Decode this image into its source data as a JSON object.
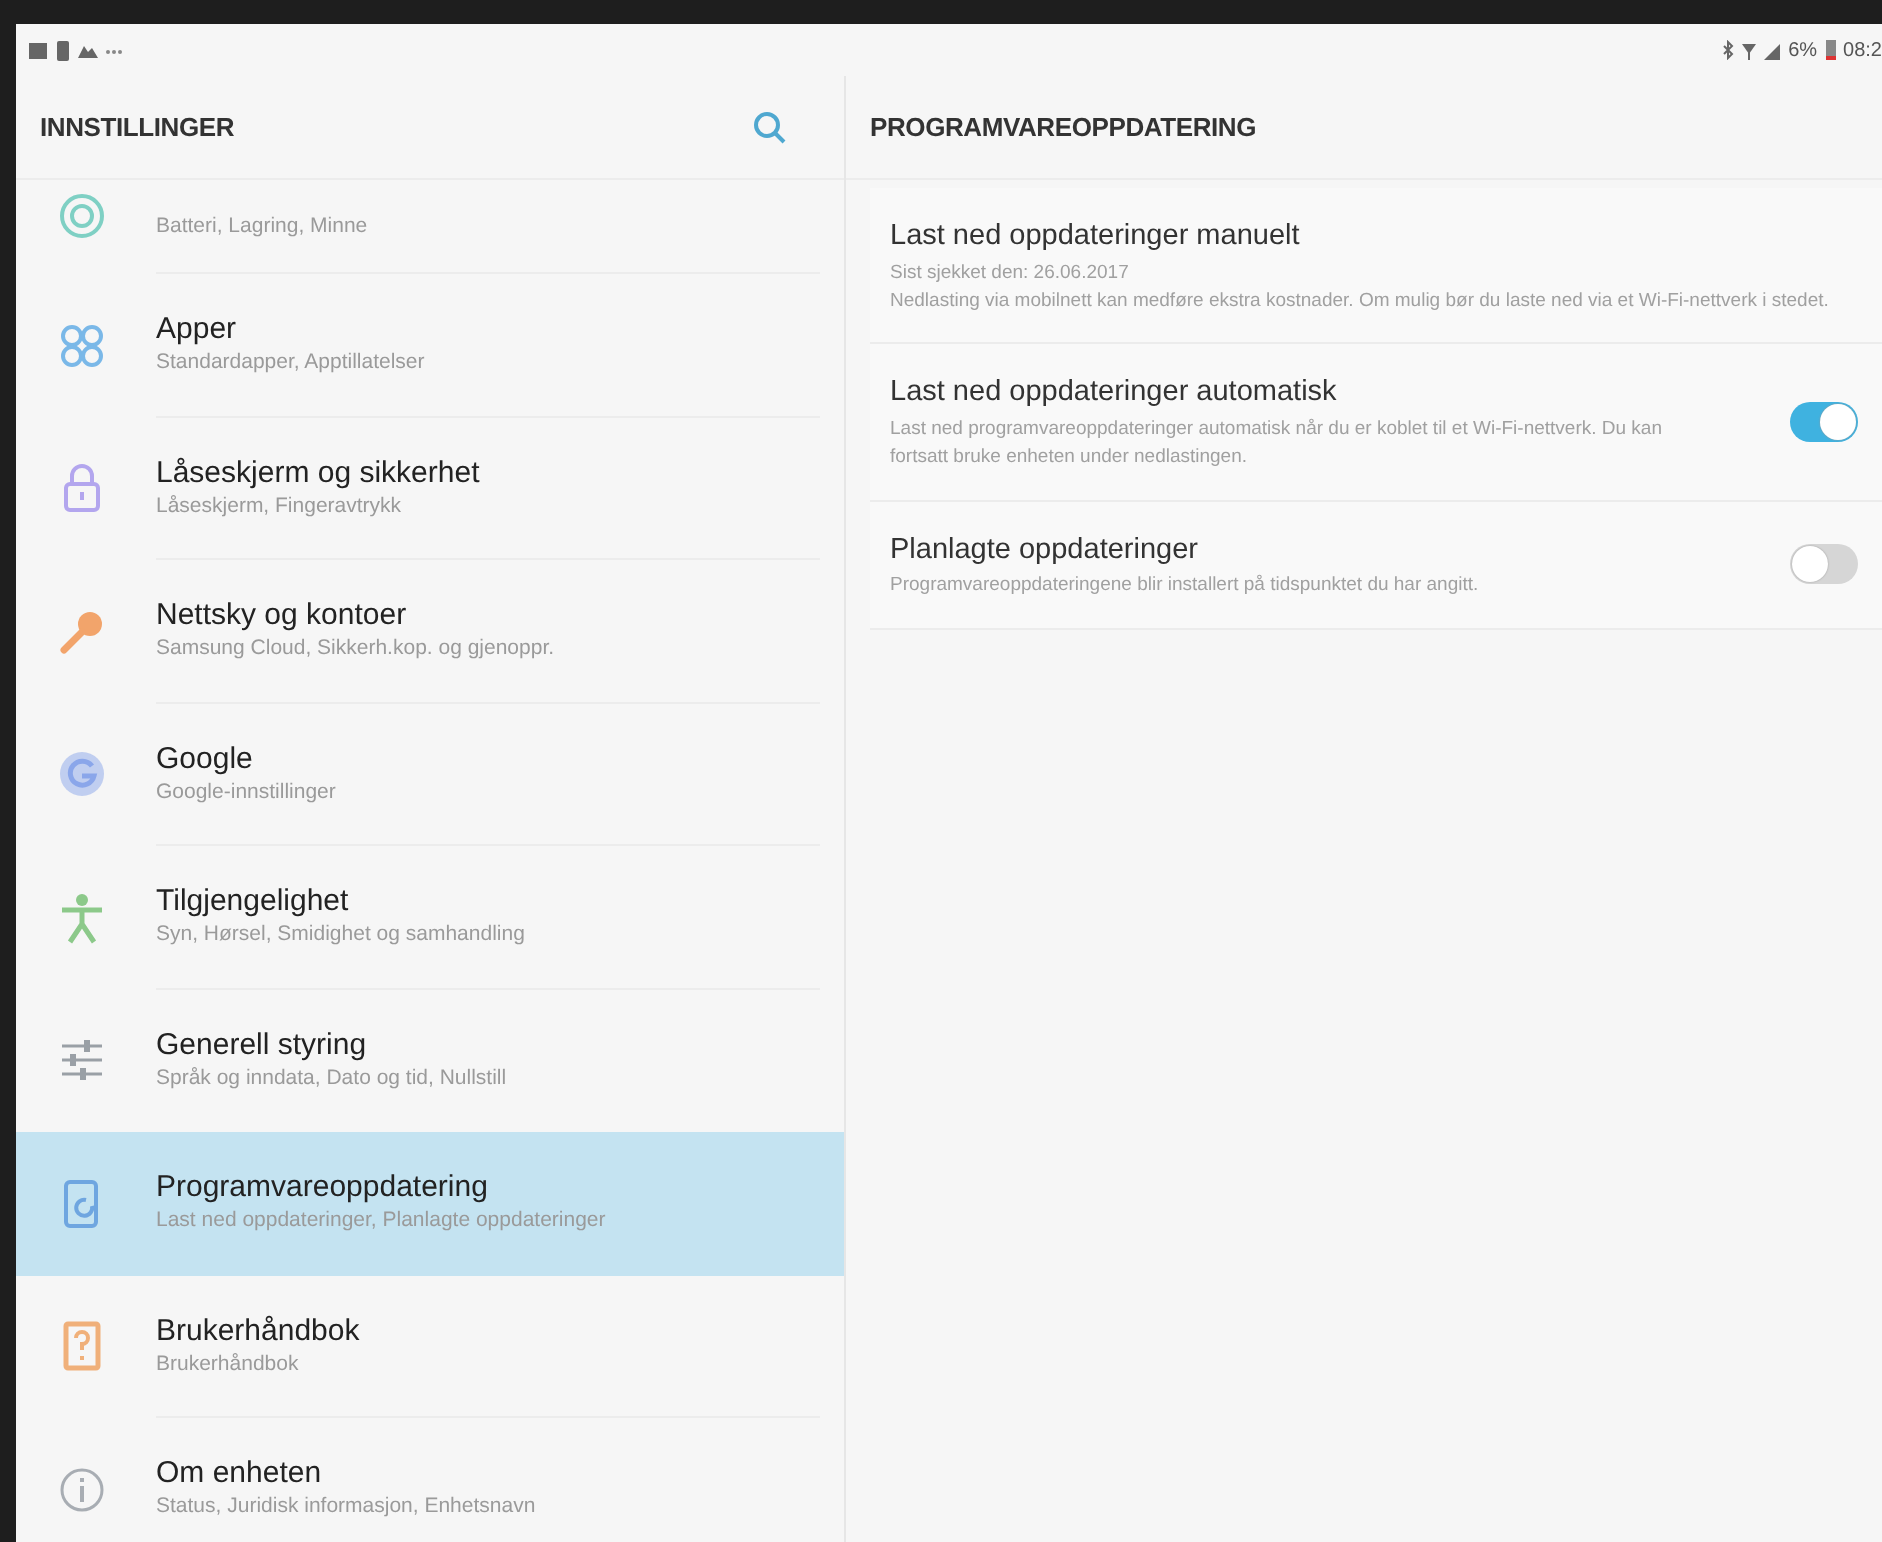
{
  "status_bar": {
    "battery": "6%",
    "time": "08:2"
  },
  "sidebar": {
    "title": "INNSTILLINGER",
    "items": [
      {
        "kind": "maintenance",
        "subtitle": "Batteri, Lagring, Minne",
        "selected": false,
        "color": "#7fd0c4"
      },
      {
        "kind": "apps",
        "title": "Apper",
        "subtitle": "Standardapper, Apptillatelser",
        "selected": false,
        "color": "#7ab8e8"
      },
      {
        "kind": "lock",
        "title": "Låseskjerm og sikkerhet",
        "subtitle": "Låseskjerm, Fingeravtrykk",
        "selected": false,
        "color": "#b3a6ee"
      },
      {
        "kind": "key",
        "title": "Nettsky og kontoer",
        "subtitle": "Samsung Cloud, Sikkerh.kop. og gjenoppr.",
        "selected": false,
        "color": "#f2a46b"
      },
      {
        "kind": "google",
        "title": "Google",
        "subtitle": "Google-innstillinger",
        "selected": false,
        "color": "#8aa6ea"
      },
      {
        "kind": "person",
        "title": "Tilgjengelighet",
        "subtitle": "Syn, Hørsel, Smidighet og samhandling",
        "selected": false,
        "color": "#8cc98a"
      },
      {
        "kind": "sliders",
        "title": "Generell styring",
        "subtitle": "Språk og inndata, Dato og tid, Nullstill",
        "selected": false,
        "color": "#9aa0a6"
      },
      {
        "kind": "update",
        "title": "Programvareoppdatering",
        "subtitle": "Last ned oppdateringer, Planlagte oppdateringer",
        "selected": true,
        "color": "#6fa6e0"
      },
      {
        "kind": "manual",
        "title": "Brukerhåndbok",
        "subtitle": "Brukerhåndbok",
        "selected": false,
        "color": "#f0b07a"
      },
      {
        "kind": "info",
        "title": "Om enheten",
        "subtitle": "Status, Juridisk informasjon, Enhetsnavn",
        "selected": false,
        "color": "#a8adb3"
      }
    ]
  },
  "detail": {
    "title": "PROGRAMVAREOPPDATERING",
    "settings": [
      {
        "title": "Last ned oppdateringer manuelt",
        "lines": [
          "Sist sjekket den: 26.06.2017",
          "Nedlasting via mobilnett kan medføre ekstra kostnader. Om mulig bør du laste ned via et Wi-Fi-nettverk i stedet."
        ]
      },
      {
        "title": "Last ned oppdateringer automatisk",
        "lines": [
          "Last ned programvareoppdateringer automatisk når du er koblet til et Wi-Fi-nettverk. Du kan fortsatt bruke enheten under nedlastingen."
        ],
        "on": true
      },
      {
        "title": "Planlagte oppdateringer",
        "lines": [
          "Programvareoppdateringene blir installert på tidspunktet du har angitt."
        ],
        "on": false
      }
    ]
  }
}
